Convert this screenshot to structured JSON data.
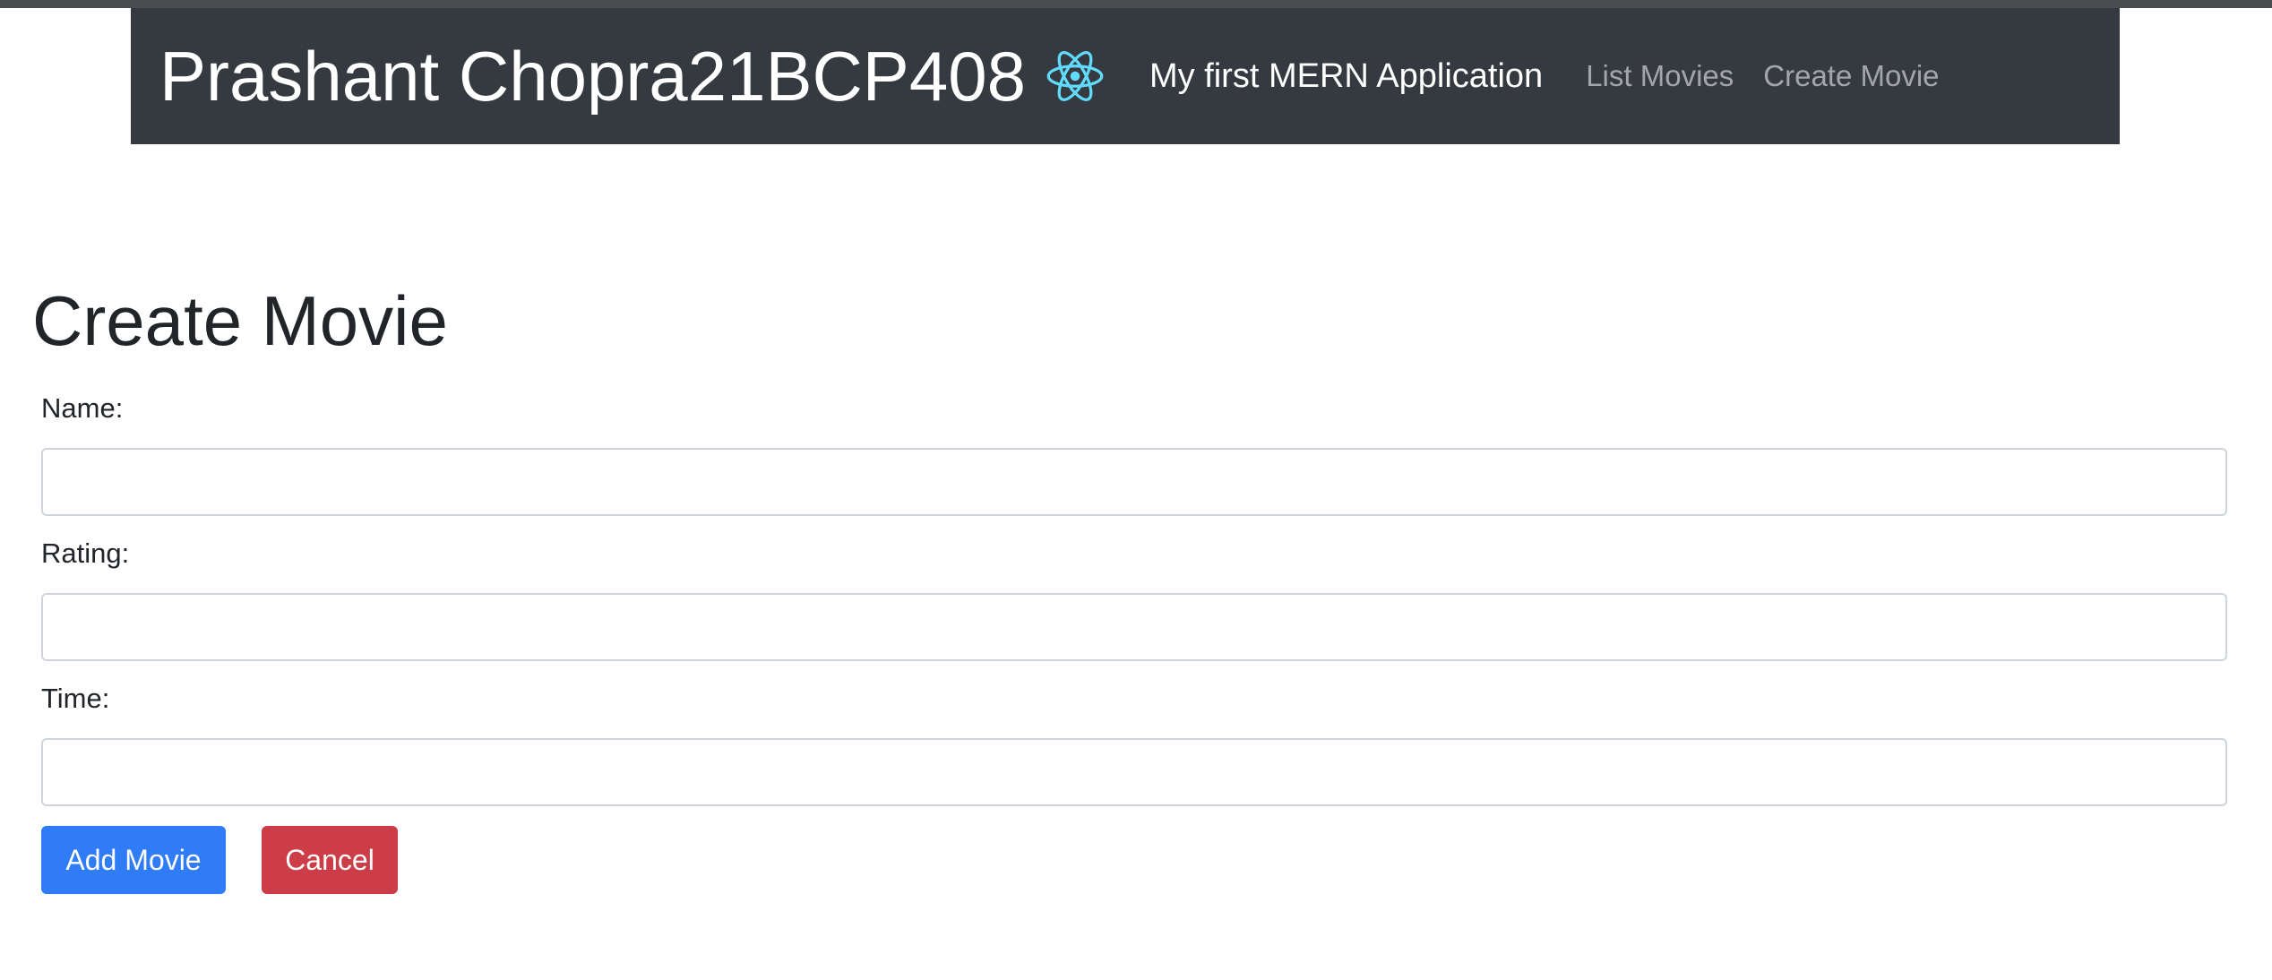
{
  "navbar": {
    "brand": "Prashant Chopra21BCP408",
    "logo_icon": "react-atom-icon",
    "app_title": "My first MERN Application",
    "links": [
      {
        "label": "List Movies"
      },
      {
        "label": "Create Movie"
      }
    ],
    "background": "#343a40"
  },
  "page": {
    "title": "Create Movie"
  },
  "form": {
    "name": {
      "label": "Name:",
      "value": ""
    },
    "rating": {
      "label": "Rating:",
      "value": ""
    },
    "time": {
      "label": "Time:",
      "value": ""
    },
    "add_button": "Add Movie",
    "cancel_button": "Cancel"
  },
  "colors": {
    "primary": "#2f7cf6",
    "danger": "#cc3d48",
    "react": "#61dafb"
  }
}
